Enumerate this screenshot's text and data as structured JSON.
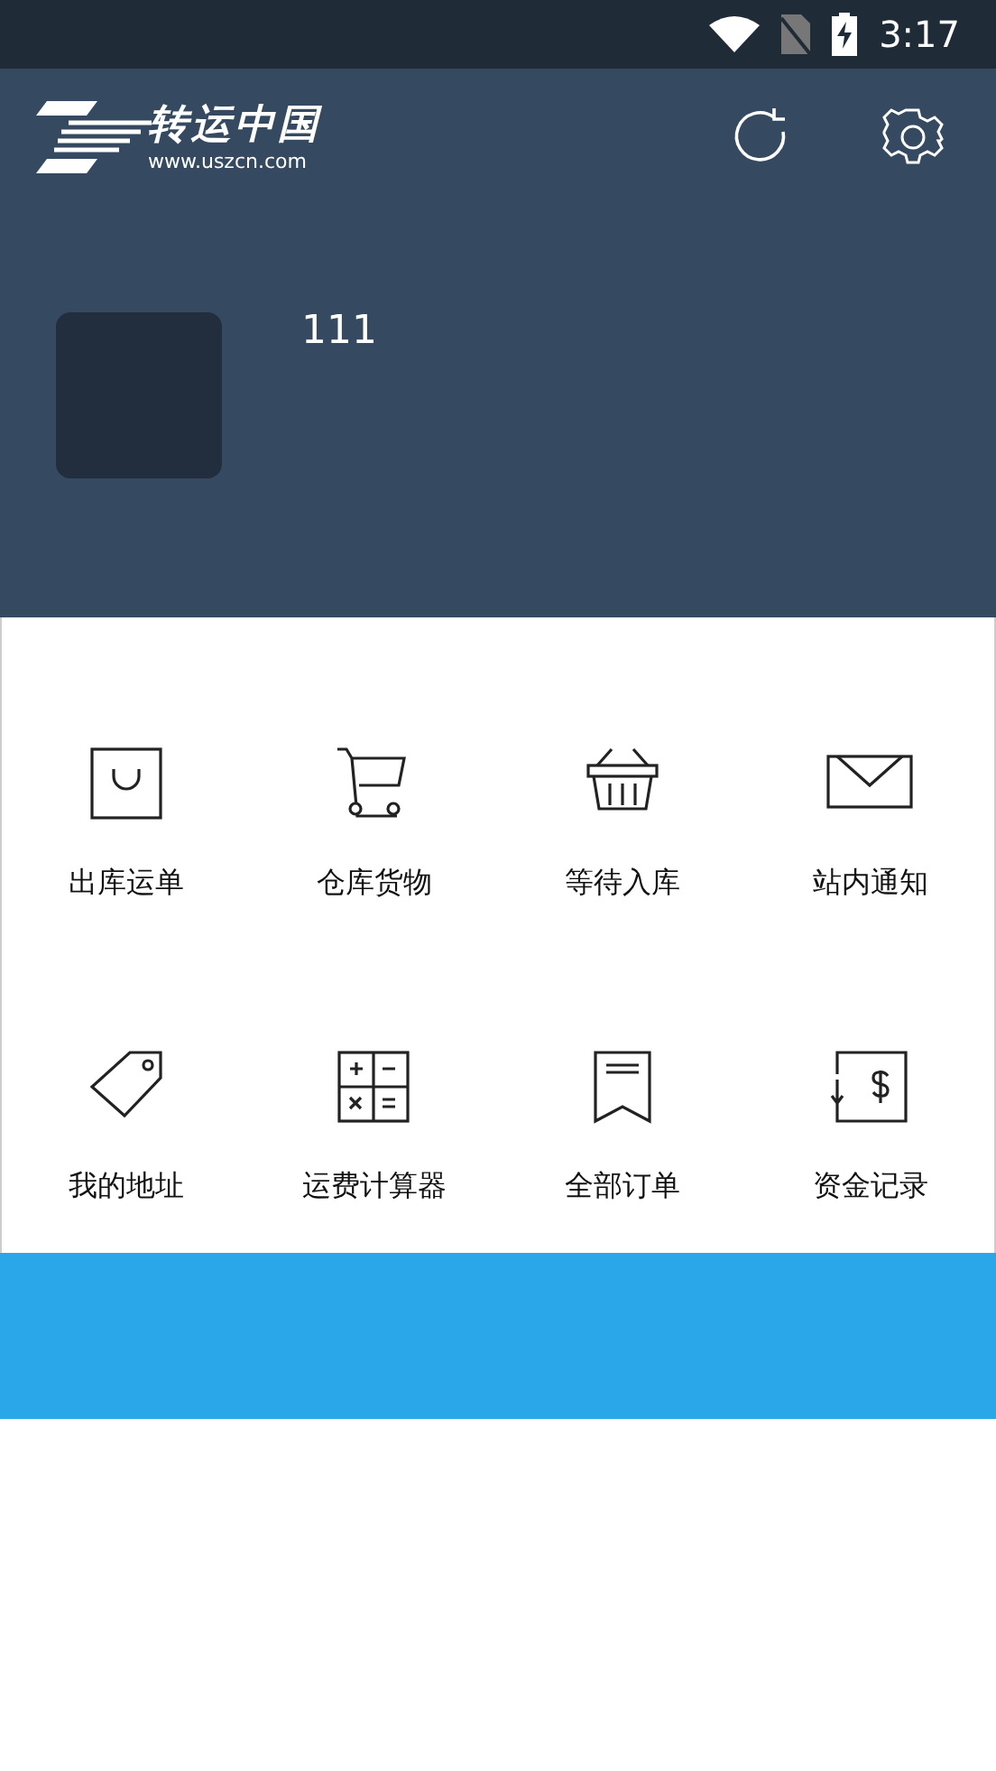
{
  "status_bar": {
    "time": "3:17"
  },
  "header": {
    "logo_title": "转运中国",
    "logo_url": "www.uszcn.com"
  },
  "profile": {
    "name": "111"
  },
  "menu": [
    {
      "label": "出库运单"
    },
    {
      "label": "仓库货物"
    },
    {
      "label": "等待入库"
    },
    {
      "label": "站内通知"
    },
    {
      "label": "我的地址"
    },
    {
      "label": "运费计算器"
    },
    {
      "label": "全部订单"
    },
    {
      "label": "资金记录"
    }
  ]
}
